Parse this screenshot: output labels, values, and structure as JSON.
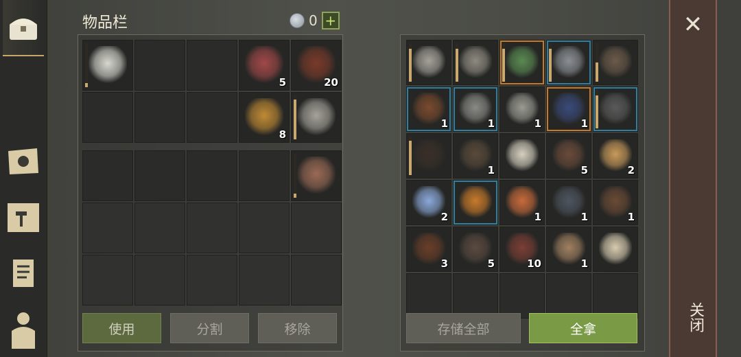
{
  "title": "物品栏",
  "currency": {
    "value": "0",
    "plus": "+"
  },
  "left_inventory": {
    "slots": [
      {
        "item": "scimitar",
        "qty": "",
        "bar": 0.1
      },
      {
        "item": "",
        "qty": ""
      },
      {
        "item": "",
        "qty": ""
      },
      {
        "item": "berry-soup",
        "qty": "5"
      },
      {
        "item": "steak",
        "qty": "20"
      },
      {
        "item": "",
        "qty": ""
      },
      {
        "item": "",
        "qty": ""
      },
      {
        "item": "",
        "qty": ""
      },
      {
        "item": "stew",
        "qty": "8"
      },
      {
        "item": "sword",
        "qty": "",
        "bar": 0.9
      }
    ]
  },
  "equip_row": {
    "slots": [
      {
        "item": "",
        "qty": ""
      },
      {
        "item": "",
        "qty": ""
      },
      {
        "item": "",
        "qty": ""
      },
      {
        "item": "",
        "qty": ""
      },
      {
        "item": "dagger",
        "qty": "",
        "bar": 0.1
      }
    ]
  },
  "right_storage": {
    "slots": [
      {
        "item": "sword",
        "qty": "",
        "bar": 0.85
      },
      {
        "item": "halberd",
        "qty": "",
        "bar": 0.85
      },
      {
        "item": "jade-sword",
        "qty": "",
        "bar": 0.85,
        "border": "orange"
      },
      {
        "item": "trident",
        "qty": "",
        "bar": 0.85,
        "border": "blue"
      },
      {
        "item": "mace",
        "qty": "",
        "bar": 0.5
      },
      {
        "item": "collar",
        "qty": "1",
        "border": "blue"
      },
      {
        "item": "millstone",
        "qty": "1",
        "border": "blue"
      },
      {
        "item": "pliers",
        "qty": "1"
      },
      {
        "item": "egg",
        "qty": "1",
        "border": "orange"
      },
      {
        "item": "helmet",
        "qty": "",
        "bar": 0.85,
        "border": "blue"
      },
      {
        "item": "pants",
        "qty": "",
        "bar": 0.9
      },
      {
        "item": "trap",
        "qty": "1"
      },
      {
        "item": "blueprint",
        "qty": ""
      },
      {
        "item": "nails",
        "qty": "5"
      },
      {
        "item": "seeds",
        "qty": "2"
      },
      {
        "item": "crystal",
        "qty": "2"
      },
      {
        "item": "tome",
        "qty": "",
        "border": "blue"
      },
      {
        "item": "hourglass",
        "qty": "1"
      },
      {
        "item": "gears",
        "qty": "1"
      },
      {
        "item": "bottle",
        "qty": "1"
      },
      {
        "item": "leather",
        "qty": "3"
      },
      {
        "item": "chain",
        "qty": "5"
      },
      {
        "item": "rope-bundle",
        "qty": "10"
      },
      {
        "item": "lasso",
        "qty": "1"
      },
      {
        "item": "scroll",
        "qty": ""
      },
      {
        "item": "",
        "qty": ""
      },
      {
        "item": "",
        "qty": ""
      },
      {
        "item": "",
        "qty": ""
      },
      {
        "item": "",
        "qty": ""
      },
      {
        "item": "",
        "qty": ""
      }
    ]
  },
  "buttons": {
    "use": "使用",
    "split": "分割",
    "remove": "移除",
    "store_all": "存储全部",
    "take_all": "全拿"
  },
  "close": {
    "label": "关闭"
  },
  "colors": {
    "accent_green": "#7a9a45",
    "orange": "#c77a2a",
    "blue": "#2f7fa3"
  }
}
